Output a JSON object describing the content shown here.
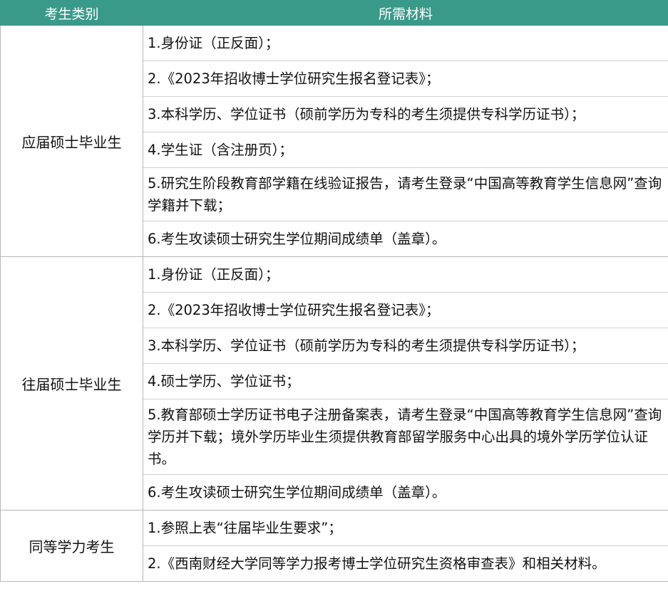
{
  "header": {
    "col1": "考生类别",
    "col2": "所需材料"
  },
  "rows": [
    {
      "category": "应届硕士毕业生",
      "items": [
        "1.身份证（正反面）；",
        "2.《2023年招收博士学位研究生报名登记表》；",
        "3.本科学历、学位证书（硕前学历为专科的考生须提供专科学历证书）；",
        "4.学生证（含注册页）；",
        "5.研究生阶段教育部学籍在线验证报告，请考生登录“中国高等教育学生信息网”查询学籍并下载；",
        "6.考生攻读硕士研究生学位期间成绩单（盖章）。"
      ]
    },
    {
      "category": "往届硕士毕业生",
      "items": [
        "1.身份证（正反面）；",
        "2.《2023年招收博士学位研究生报名登记表》；",
        "3.本科学历、学位证书（硕前学历为专科的考生须提供专科学历证书）；",
        "4.硕士学历、学位证书；",
        "5.教育部硕士学历证书电子注册备案表，请考生登录“中国高等教育学生信息网”查询学历并下载；境外学历毕业生须提供教育部留学服务中心出具的境外学历学位认证书。",
        "6.考生攻读硕士研究生学位期间成绩单（盖章）。"
      ]
    },
    {
      "category": "同等学力考生",
      "items": [
        "1.参照上表“往届毕业生要求”；",
        "2.《西南财经大学同等学力报考博士学位研究生资格审查表》和相关材料。"
      ]
    }
  ]
}
